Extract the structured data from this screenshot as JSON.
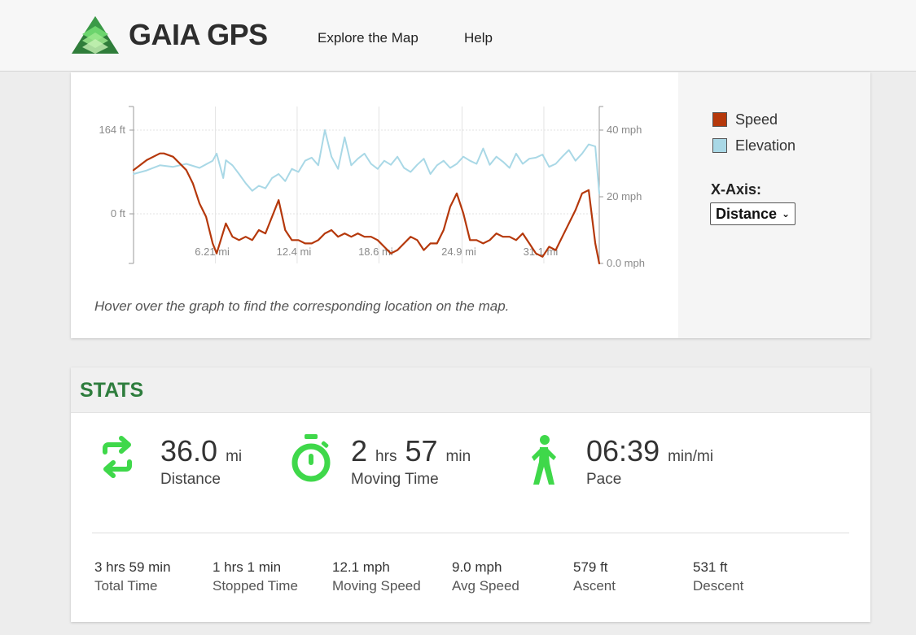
{
  "header": {
    "brand": "GAIA GPS",
    "nav": [
      "Explore the Map",
      "Help"
    ]
  },
  "chart": {
    "legend": [
      {
        "name": "Speed",
        "color": "#b5380b"
      },
      {
        "name": "Elevation",
        "color": "#a9d8e6"
      }
    ],
    "xaxis_label": "X-Axis:",
    "xaxis_selected": "Distance",
    "hint": "Hover over the graph to find the corresponding location on the map."
  },
  "chart_data": {
    "type": "line",
    "x_ticks": [
      "6.21 mi",
      "12.4 mi",
      "18.6 mi",
      "24.9 mi",
      "31.1 mi"
    ],
    "x_tick_values": [
      6.21,
      12.4,
      18.6,
      24.9,
      31.1
    ],
    "xlim": [
      0,
      35.3
    ],
    "left_ticks": [
      "164 ft",
      "0 ft"
    ],
    "left_tick_values": [
      164,
      0
    ],
    "right_ticks": [
      "40 mph",
      "20 mph",
      "0.0 mph"
    ],
    "right_tick_values": [
      40,
      20,
      0
    ],
    "grid": true,
    "legend_position": "right",
    "series": [
      {
        "name": "Elevation",
        "axis": "left",
        "unit": "ft",
        "color": "#a9d8e6",
        "x": [
          0,
          1,
          2,
          3,
          4,
          5,
          6,
          6.3,
          6.8,
          7,
          7.5,
          8,
          8.5,
          9,
          9.5,
          10,
          10.5,
          11,
          11.5,
          12,
          12.5,
          13,
          13.5,
          14,
          14.5,
          15,
          15.5,
          16,
          16.5,
          17,
          17.5,
          18,
          18.5,
          19,
          19.5,
          20,
          20.5,
          21,
          21.5,
          22,
          22.5,
          23,
          23.5,
          24,
          24.5,
          25,
          25.5,
          26,
          26.5,
          27,
          27.5,
          28,
          28.5,
          29,
          29.5,
          30,
          30.5,
          31,
          31.5,
          32,
          32.5,
          33,
          33.5,
          34,
          34.5,
          35,
          35.3
        ],
        "y": [
          78,
          85,
          95,
          92,
          98,
          90,
          104,
          118,
          70,
          105,
          95,
          78,
          60,
          45,
          55,
          50,
          70,
          78,
          64,
          88,
          82,
          104,
          110,
          95,
          164,
          112,
          88,
          150,
          95,
          108,
          118,
          98,
          88,
          104,
          96,
          112,
          90,
          82,
          96,
          108,
          78,
          95,
          104,
          90,
          98,
          112,
          104,
          98,
          128,
          96,
          112,
          102,
          90,
          118,
          98,
          108,
          110,
          116,
          92,
          98,
          112,
          125,
          104,
          118,
          136,
          132,
          40
        ]
      },
      {
        "name": "Speed",
        "axis": "right",
        "unit": "mph",
        "color": "#b5380b",
        "x": [
          0,
          1,
          2,
          2.3,
          3,
          4,
          4.5,
          5,
          5.5,
          6,
          6.3,
          7,
          7.5,
          8,
          8.5,
          9,
          9.5,
          10,
          10.5,
          11,
          11.5,
          12,
          12.5,
          13,
          13.5,
          14,
          14.5,
          15,
          15.5,
          16,
          16.5,
          17,
          17.5,
          18,
          18.5,
          19,
          19.5,
          20,
          20.5,
          21,
          21.5,
          22,
          22.5,
          23,
          23.5,
          24,
          24.5,
          25,
          25.5,
          26,
          26.5,
          27,
          27.5,
          28,
          28.5,
          29,
          29.5,
          30,
          30.5,
          31,
          31.5,
          32,
          32.5,
          33,
          33.5,
          34,
          34.5,
          35,
          35.3
        ],
        "y": [
          28,
          31,
          33,
          33,
          32,
          28,
          24,
          18,
          14,
          6,
          3,
          12,
          8,
          7,
          8,
          7,
          10,
          9,
          14,
          19,
          10,
          7,
          7,
          6,
          6,
          7,
          9,
          10,
          8,
          9,
          8,
          9,
          8,
          8,
          7,
          5,
          3,
          4,
          6,
          8,
          7,
          4,
          6,
          6,
          10,
          17,
          21,
          15,
          7,
          7,
          6,
          7,
          9,
          8,
          8,
          7,
          9,
          6,
          3,
          2,
          5,
          4,
          8,
          12,
          16,
          21,
          22,
          6,
          0
        ]
      }
    ]
  },
  "stats": {
    "title": "STATS",
    "distance": {
      "value": "36.0",
      "unit": "mi",
      "label": "Distance"
    },
    "moving_time": {
      "hrs": "2",
      "hrs_unit": "hrs",
      "min": "57",
      "min_unit": "min",
      "label": "Moving Time"
    },
    "pace": {
      "value": "06:39",
      "unit": "min/mi",
      "label": "Pace"
    },
    "secondary": [
      {
        "value": "3 hrs 59 min",
        "label": "Total Time"
      },
      {
        "value": "1 hrs 1 min",
        "label": "Stopped Time"
      },
      {
        "value": "12.1 mph",
        "label": "Moving Speed"
      },
      {
        "value": "9.0 mph",
        "label": "Avg Speed"
      },
      {
        "value": "579 ft",
        "label": "Ascent"
      },
      {
        "value": "531 ft",
        "label": "Descent"
      }
    ],
    "icon_color": "#3fd84a"
  }
}
